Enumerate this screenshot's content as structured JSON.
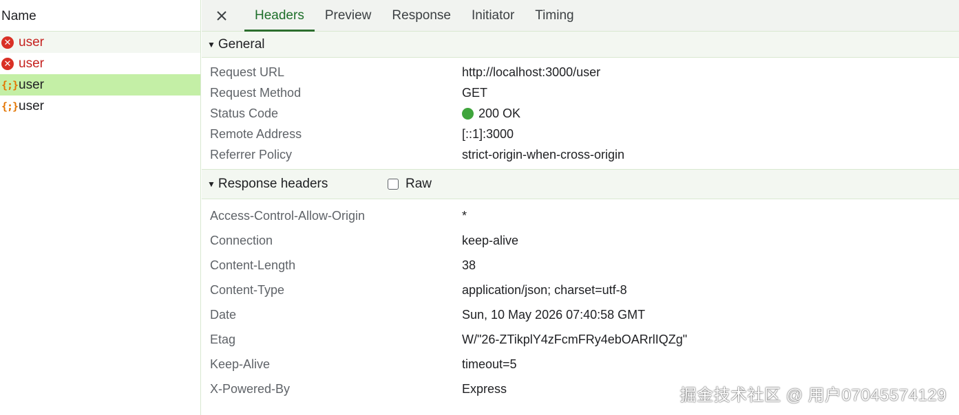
{
  "request_list": {
    "column_header": "Name",
    "items": [
      {
        "label": "user",
        "status": "error",
        "icon": "error-icon"
      },
      {
        "label": "user",
        "status": "error",
        "icon": "error-icon"
      },
      {
        "label": "user",
        "status": "ok",
        "icon": "fetch-icon",
        "selected": true
      },
      {
        "label": "user",
        "status": "ok",
        "icon": "fetch-icon"
      }
    ]
  },
  "tabs": {
    "close_icon": "close-icon",
    "items": [
      {
        "label": "Headers",
        "active": true
      },
      {
        "label": "Preview"
      },
      {
        "label": "Response"
      },
      {
        "label": "Initiator"
      },
      {
        "label": "Timing"
      }
    ]
  },
  "general": {
    "title": "General",
    "rows": [
      {
        "key": "Request URL",
        "value": "http://localhost:3000/user"
      },
      {
        "key": "Request Method",
        "value": "GET"
      },
      {
        "key": "Status Code",
        "value": "200 OK"
      },
      {
        "key": "Remote Address",
        "value": "[::1]:3000"
      },
      {
        "key": "Referrer Policy",
        "value": "strict-origin-when-cross-origin"
      }
    ]
  },
  "response_headers": {
    "title": "Response headers",
    "raw_label": "Raw",
    "raw_checked": false,
    "rows": [
      {
        "key": "Access-Control-Allow-Origin",
        "value": "*"
      },
      {
        "key": "Connection",
        "value": "keep-alive"
      },
      {
        "key": "Content-Length",
        "value": "38"
      },
      {
        "key": "Content-Type",
        "value": "application/json; charset=utf-8"
      },
      {
        "key": "Date",
        "value": "Sun, 10 May 2026 07:40:58 GMT"
      },
      {
        "key": "Etag",
        "value": "W/\"26-ZTikplY4zFcmFRy4ebOARrlIQZg\""
      },
      {
        "key": "Keep-Alive",
        "value": "timeout=5"
      },
      {
        "key": "X-Powered-By",
        "value": "Express"
      }
    ]
  },
  "colors": {
    "selected_row": "#c4efa6",
    "error_text": "#c5221f",
    "status_ok": "#3fa53c",
    "active_tab": "#2c6e2e"
  },
  "watermark": "掘金技术社区 @ 用户07045574129"
}
